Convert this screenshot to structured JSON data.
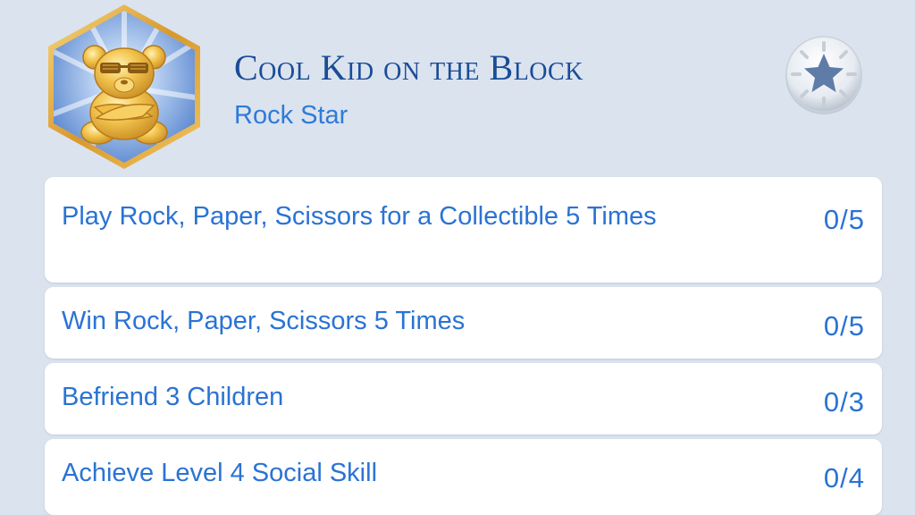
{
  "achievement": {
    "title": "Cool Kid on the Block",
    "category": "Rock Star",
    "badge_icon": "teddy-bear-with-sunglasses-icon",
    "action_icon": "star-icon"
  },
  "colors": {
    "background": "#dbe3ef",
    "title": "#1a4c97",
    "accent": "#2a73d4",
    "badge_border": "#e0a93a"
  },
  "goals": [
    {
      "label": "Play Rock, Paper, Scissors for a Collectible 5 Times",
      "progress": "0/5"
    },
    {
      "label": "Win Rock, Paper, Scissors 5 Times",
      "progress": "0/5"
    },
    {
      "label": "Befriend 3 Children",
      "progress": "0/3"
    },
    {
      "label": "Achieve Level 4 Social Skill",
      "progress": "0/4"
    }
  ]
}
